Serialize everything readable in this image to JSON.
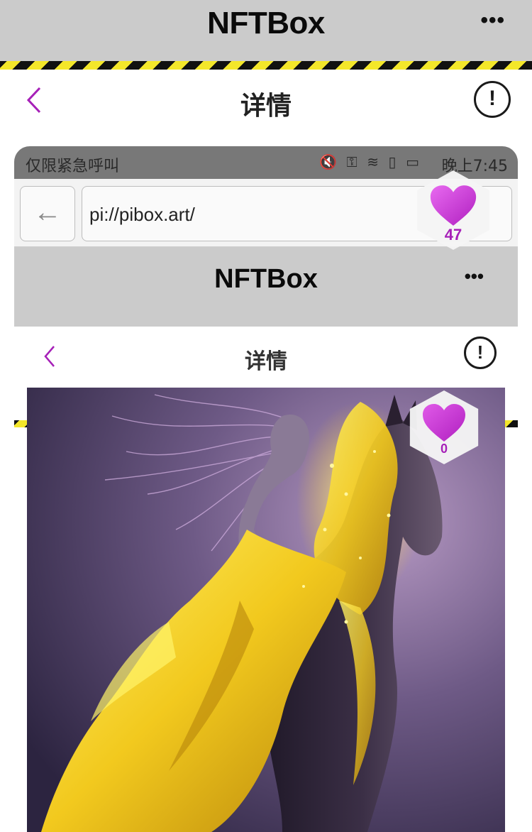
{
  "appbar": {
    "title": "NFTBox",
    "more": "•••"
  },
  "nav": {
    "title": "详情",
    "info_glyph": "!"
  },
  "screenshot": {
    "status": {
      "left_text": "仅限紧急呼叫",
      "time": "晚上7:45"
    },
    "browser": {
      "back_glyph": "←",
      "url": "pi://pibox.art/"
    },
    "appbar": {
      "title": "NFTBox",
      "more": "•••"
    },
    "nav": {
      "title": "详情",
      "info_glyph": "!"
    },
    "artwork_like": {
      "count": "0"
    }
  },
  "floating_like": {
    "count": "47"
  },
  "colors": {
    "accent": "#a620b8",
    "heart": "#cc2fd6",
    "bar": "#cbcbcb",
    "hazard_yellow": "#f4e72a"
  }
}
